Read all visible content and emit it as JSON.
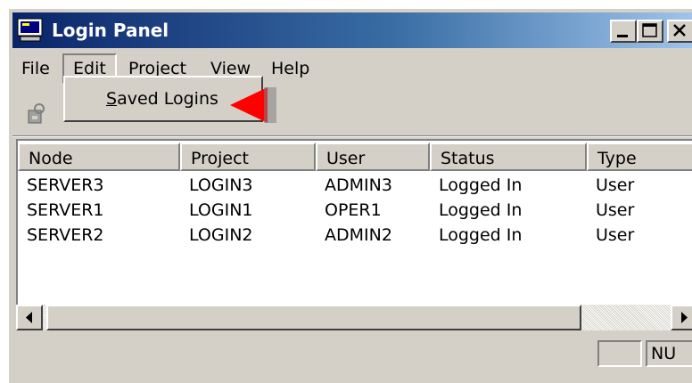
{
  "window": {
    "title": "Login Panel",
    "app_icon": "monitor-icon"
  },
  "title_buttons": [
    {
      "name": "minimize",
      "icon": "minimize-icon"
    },
    {
      "name": "maximize",
      "icon": "maximize-icon"
    },
    {
      "name": "close",
      "icon": "close-icon"
    }
  ],
  "menubar": {
    "items": [
      {
        "label": "File"
      },
      {
        "label": "Edit",
        "open": true
      },
      {
        "label": "Project"
      },
      {
        "label": "View"
      },
      {
        "label": "Help"
      }
    ]
  },
  "toolbar": {
    "icon": "login-icon"
  },
  "dropdown": {
    "items": [
      {
        "label_underlined": "S",
        "label_rest": "aved Logins"
      }
    ]
  },
  "annotation": {
    "arrow_color": "#ff0000",
    "icon": "red-arrow-icon"
  },
  "table": {
    "columns": [
      "Node",
      "Project",
      "User",
      "Status",
      "Type"
    ],
    "rows": [
      [
        "SERVER3",
        "LOGIN3",
        "ADMIN3",
        "Logged In",
        "User"
      ],
      [
        "SERVER1",
        "LOGIN1",
        "OPER1",
        "Logged In",
        "User"
      ],
      [
        "SERVER2",
        "LOGIN2",
        "ADMIN2",
        "Logged In",
        "User"
      ]
    ]
  },
  "statusbar": {
    "panels": [
      "",
      "NU"
    ]
  },
  "colors": {
    "title_start": "#0a246a",
    "title_end": "#a6caf0",
    "face": "#d4d0c8"
  }
}
